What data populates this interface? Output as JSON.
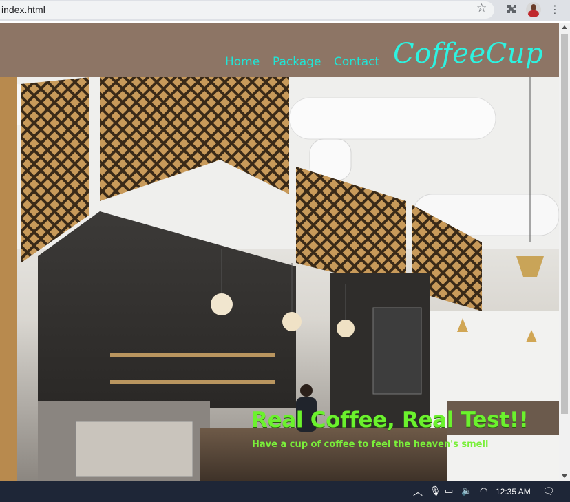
{
  "browser": {
    "url": "index.html",
    "icons": [
      "star-icon",
      "extensions-icon",
      "profile-avatar",
      "more-icon"
    ]
  },
  "nav": {
    "links": [
      {
        "label": "Home"
      },
      {
        "label": "Package"
      },
      {
        "label": "Contact"
      }
    ],
    "brand": "CoffeeCup"
  },
  "hero": {
    "headline": "Real Coffee, Real Test!!",
    "subtitle": "Have a cup of coffee to feel the heaven's smell"
  },
  "taskbar": {
    "time": "12:35 AM",
    "icons": [
      "chevron-up-icon",
      "microphone-icon",
      "battery-icon",
      "volume-icon",
      "wifi-icon",
      "notification-icon"
    ]
  },
  "colors": {
    "navbar": "#8d7565",
    "nav_text": "#20e5d6",
    "headline": "#6bf22d"
  }
}
